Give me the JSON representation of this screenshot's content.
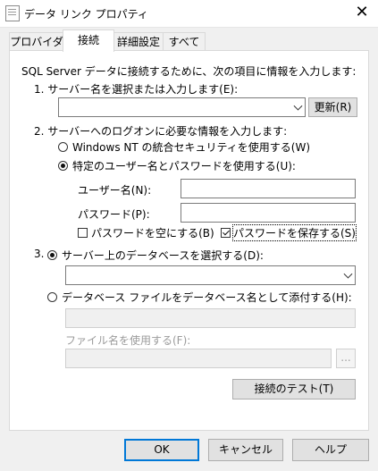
{
  "window": {
    "title": "データ リンク プロパティ"
  },
  "tabs": [
    {
      "label": "プロバイダー"
    },
    {
      "label": "接続"
    },
    {
      "label": "詳細設定"
    },
    {
      "label": "すべて"
    }
  ],
  "intro": "SQL Server データに接続するために、次の項目に情報を入力します:",
  "step1": {
    "label": "1. サーバー名を選択または入力します(E):",
    "server_value": "",
    "refresh": "更新(R)"
  },
  "step2": {
    "label": "2. サーバーへのログオンに必要な情報を入力します:",
    "opt_nt": "Windows NT の統合セキュリティを使用する(W)",
    "opt_user": "特定のユーザー名とパスワードを使用する(U):",
    "username_label": "ユーザー名(N):",
    "password_label": "パスワード(P):",
    "username_value": "",
    "password_value": "",
    "blank_pw": "パスワードを空にする(B)",
    "save_pw": "パスワードを保存する(S)"
  },
  "step3": {
    "prefix": "3.",
    "opt_db": "サーバー上のデータベースを選択する(D):",
    "db_value": "",
    "opt_attach": "データベース ファイルをデータベース名として添付する(H):",
    "attach_value": "",
    "filename_label": "ファイル名を使用する(F):",
    "filename_value": "",
    "browse": "..."
  },
  "test_button": "接続のテスト(T)",
  "footer": {
    "ok": "OK",
    "cancel": "キャンセル",
    "help": "ヘルプ"
  }
}
